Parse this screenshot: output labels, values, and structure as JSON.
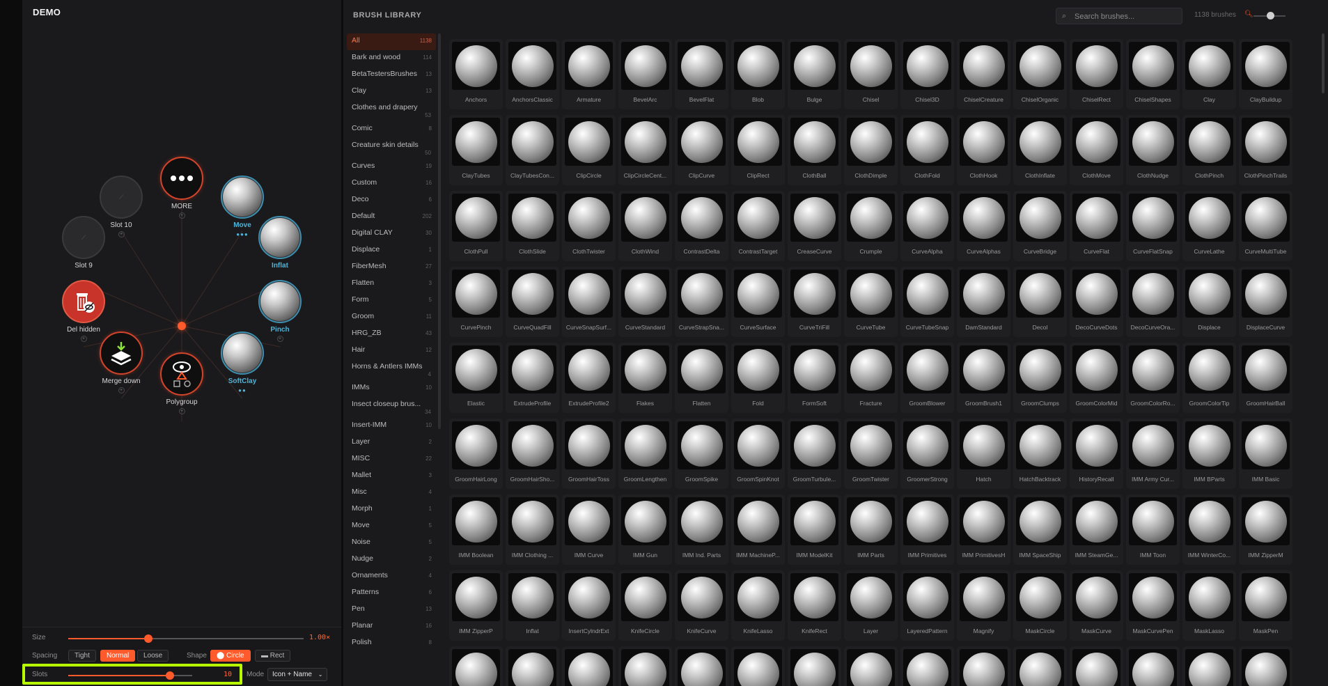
{
  "left_panel": {
    "title": "DEMO",
    "slots": [
      {
        "id": "more",
        "label": "MORE",
        "style": "red",
        "icon": "ellipsis-icon"
      },
      {
        "id": "move",
        "label": "Move",
        "style": "blue",
        "icon": "brush-sphere",
        "dots": "●●●"
      },
      {
        "id": "inflat",
        "label": "Inflat",
        "style": "blue",
        "icon": "brush-sphere"
      },
      {
        "id": "pinch",
        "label": "Pinch",
        "style": "blue",
        "icon": "brush-sphere"
      },
      {
        "id": "softclay",
        "label": "SoftClay",
        "style": "blue",
        "icon": "brush-sphere",
        "dots": "●●"
      },
      {
        "id": "polygroup",
        "label": "Polygroup",
        "style": "red",
        "icon": "eye-shapes-icon"
      },
      {
        "id": "merge-down",
        "label": "Merge down",
        "style": "red",
        "icon": "layers-merge-icon"
      },
      {
        "id": "del-hidden",
        "label": "Del hidden",
        "style": "redfill",
        "icon": "trash-hidden-icon"
      },
      {
        "id": "slot-9",
        "label": "Slot 9",
        "style": "empty",
        "icon": "empty-slot-icon"
      },
      {
        "id": "slot-10",
        "label": "Slot 10",
        "style": "empty",
        "icon": "empty-slot-icon"
      }
    ],
    "controls": {
      "size_label": "Size",
      "size_value": "1.00×",
      "size_fraction": 0.34,
      "spacing_label": "Spacing",
      "spacing_options": [
        "Tight",
        "Normal",
        "Loose"
      ],
      "spacing_selected": "Normal",
      "shape_label": "Shape",
      "shape_options": [
        "⬤ Circle",
        "▬ Rect"
      ],
      "shape_selected": "⬤ Circle",
      "slots_label": "Slots",
      "slots_value": "10",
      "slots_fraction": 0.82,
      "mode_label": "Mode",
      "mode_value": "Icon + Name"
    },
    "colors": {
      "accent": "#ff5a2c",
      "blue": "#4fb4d8",
      "highlight": "#b7ff00"
    }
  },
  "library": {
    "title": "BRUSH LIBRARY",
    "search_placeholder": "Search brushes...",
    "count_text": "1138 brushes",
    "categories": [
      {
        "name": "All",
        "count": "1138",
        "selected": true
      },
      {
        "name": "Bark and wood",
        "count": "114"
      },
      {
        "name": "BetaTestersBrushes",
        "count": "13"
      },
      {
        "name": "Clay",
        "count": "13"
      },
      {
        "name": "Clothes and drapery",
        "count": "53",
        "wrap": true
      },
      {
        "name": "Comic",
        "count": "8"
      },
      {
        "name": "Creature skin details",
        "count": "50",
        "wrap": true
      },
      {
        "name": "Curves",
        "count": "19"
      },
      {
        "name": "Custom",
        "count": "16"
      },
      {
        "name": "Deco",
        "count": "6"
      },
      {
        "name": "Default",
        "count": "202"
      },
      {
        "name": "Digital CLAY",
        "count": "30"
      },
      {
        "name": "Displace",
        "count": "1"
      },
      {
        "name": "FiberMesh",
        "count": "27"
      },
      {
        "name": "Flatten",
        "count": "3"
      },
      {
        "name": "Form",
        "count": "5"
      },
      {
        "name": "Groom",
        "count": "11"
      },
      {
        "name": "HRG_ZB",
        "count": "43"
      },
      {
        "name": "Hair",
        "count": "12"
      },
      {
        "name": "Horns & Antlers IMMs",
        "count": "4",
        "wrap": true
      },
      {
        "name": "IMMs",
        "count": "10"
      },
      {
        "name": "Insect closeup brus...",
        "count": "34",
        "wrap": true
      },
      {
        "name": "Insert-IMM",
        "count": "10"
      },
      {
        "name": "Layer",
        "count": "2"
      },
      {
        "name": "MISC",
        "count": "22"
      },
      {
        "name": "Mallet",
        "count": "3"
      },
      {
        "name": "Misc",
        "count": "4"
      },
      {
        "name": "Morph",
        "count": "1"
      },
      {
        "name": "Move",
        "count": "5"
      },
      {
        "name": "Noise",
        "count": "5"
      },
      {
        "name": "Nudge",
        "count": "2"
      },
      {
        "name": "Ornaments",
        "count": "4"
      },
      {
        "name": "Patterns",
        "count": "6"
      },
      {
        "name": "Pen",
        "count": "13"
      },
      {
        "name": "Planar",
        "count": "16"
      },
      {
        "name": "Polish",
        "count": "8"
      }
    ],
    "brushes": [
      "Anchors",
      "AnchorsClassic",
      "Armature",
      "BevelArc",
      "BevelFlat",
      "Blob",
      "Bulge",
      "Chisel",
      "Chisel3D",
      "ChiselCreature",
      "ChiselOrganic",
      "ChiselRect",
      "ChiselShapes",
      "Clay",
      "ClayBuildup",
      "ClayTubes",
      "ClayTubesCon...",
      "ClipCircle",
      "ClipCircleCent...",
      "ClipCurve",
      "ClipRect",
      "ClothBall",
      "ClothDimple",
      "ClothFold",
      "ClothHook",
      "ClothInflate",
      "ClothMove",
      "ClothNudge",
      "ClothPinch",
      "ClothPinchTrails",
      "ClothPull",
      "ClothSlide",
      "ClothTwister",
      "ClothWind",
      "ContrastDelta",
      "ContrastTarget",
      "CreaseCurve",
      "Crumple",
      "CurveAlpha",
      "CurveAlphas",
      "CurveBridge",
      "CurveFlat",
      "CurveFlatSnap",
      "CurveLathe",
      "CurveMultiTube",
      "CurvePinch",
      "CurveQuadFill",
      "CurveSnapSurf...",
      "CurveStandard",
      "CurveStrapSna...",
      "CurveSurface",
      "CurveTriFill",
      "CurveTube",
      "CurveTubeSnap",
      "DamStandard",
      "Decol",
      "DecoCurveDots",
      "DecoCurveOra...",
      "Displace",
      "DisplaceCurve",
      "Elastic",
      "ExtrudeProfile",
      "ExtrudeProfile2",
      "Flakes",
      "Flatten",
      "Fold",
      "FormSoft",
      "Fracture",
      "GroomBlower",
      "GroomBrush1",
      "GroomClumps",
      "GroomColorMid",
      "GroomColorRo...",
      "GroomColorTip",
      "GroomHairBall",
      "GroomHairLong",
      "GroomHairSho...",
      "GroomHairToss",
      "GroomLengthen",
      "GroomSpike",
      "GroomSpinKnot",
      "GroomTurbule...",
      "GroomTwister",
      "GroomerStrong",
      "Hatch",
      "HatchBacktrack",
      "HistoryRecall",
      "IMM Army Cur...",
      "IMM BParts",
      "IMM Basic",
      "IMM Boolean",
      "IMM Clothing ...",
      "IMM Curve",
      "IMM Gun",
      "IMM Ind. Parts",
      "IMM MachineP...",
      "IMM ModelKit",
      "IMM Parts",
      "IMM Primitives",
      "IMM PrimitivesH",
      "IMM SpaceShip",
      "IMM SteamGe...",
      "IMM Toon",
      "IMM WinterCo...",
      "IMM ZipperM",
      "IMM ZipperP",
      "Inflat",
      "InsertCylndrExt",
      "KnifeCircle",
      "KnifeCurve",
      "KnifeLasso",
      "KnifeRect",
      "Layer",
      "LayeredPattern",
      "Magnify",
      "MaskCircle",
      "MaskCurve",
      "MaskCurvePen",
      "MaskLasso",
      "MaskPen",
      "",
      "",
      "",
      "",
      "",
      "",
      "",
      "",
      "",
      "",
      "",
      "",
      "",
      "",
      ""
    ]
  }
}
